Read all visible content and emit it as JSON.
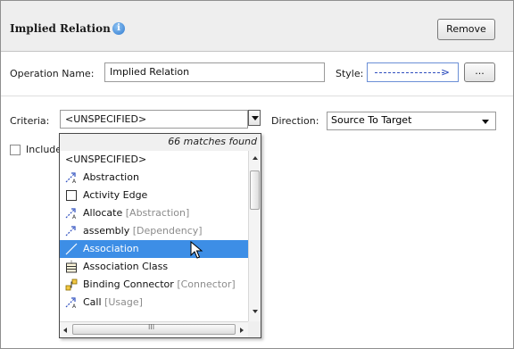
{
  "header": {
    "title": "Implied Relation",
    "remove_label": "Remove"
  },
  "operation": {
    "name_label": "Operation Name:",
    "name_value": "Implied Relation",
    "style_label": "Style:",
    "style_button_label": "..."
  },
  "criteria": {
    "label": "Criteria:",
    "value": "<UNSPECIFIED>"
  },
  "direction": {
    "label": "Direction:",
    "value": "Source To Target"
  },
  "include": {
    "label": "Include",
    "checked": false
  },
  "dropdown": {
    "matches": "66 matches found",
    "items": [
      {
        "label": "<UNSPECIFIED>",
        "hint": "",
        "icon": "none-icon"
      },
      {
        "label": "Abstraction",
        "hint": "",
        "icon": "abstraction-icon"
      },
      {
        "label": "Activity Edge",
        "hint": "",
        "icon": "activity-edge-icon"
      },
      {
        "label": "Allocate",
        "hint": "[Abstraction]",
        "icon": "allocate-icon"
      },
      {
        "label": "assembly",
        "hint": "[Dependency]",
        "icon": "assembly-icon"
      },
      {
        "label": "Association",
        "hint": "",
        "icon": "association-icon",
        "selected": true
      },
      {
        "label": "Association Class",
        "hint": "",
        "icon": "association-class-icon"
      },
      {
        "label": "Binding Connector",
        "hint": "[Connector]",
        "icon": "binding-connector-icon"
      },
      {
        "label": "Call",
        "hint": "[Usage]",
        "icon": "call-icon"
      }
    ],
    "hscroll_grip": "III"
  },
  "colors": {
    "selection": "#3d8ee6",
    "style_line": "#2f4fbf",
    "info": "#2e7ad1"
  }
}
